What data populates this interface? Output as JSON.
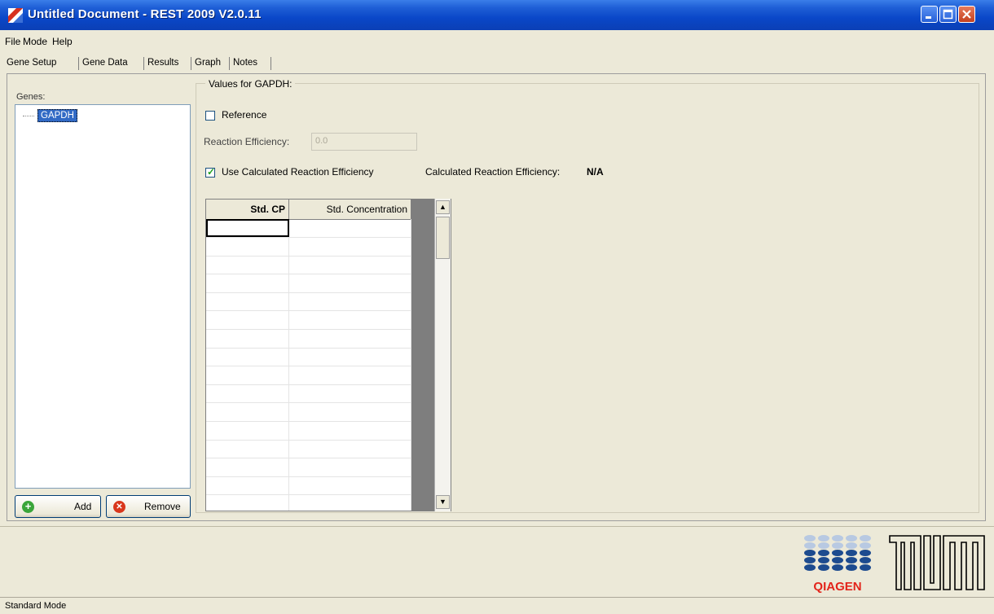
{
  "window": {
    "title": "Untitled Document - REST 2009 V2.0.11",
    "title_bar_color": "#0b47c8",
    "close_button_color": "#c4401f"
  },
  "menu": [
    {
      "label": "File"
    },
    {
      "label": "Mode"
    },
    {
      "label": "Help"
    }
  ],
  "tabs": [
    {
      "label": "Gene Setup",
      "active": true
    },
    {
      "label": "Gene Data"
    },
    {
      "label": "Results"
    },
    {
      "label": "Graph"
    },
    {
      "label": "Notes"
    }
  ],
  "genes": {
    "label": "Genes:",
    "items": [
      "GAPDH"
    ],
    "selected": "GAPDH",
    "add_label": "Add",
    "remove_label": "Remove",
    "add_icon": "plus-circle-icon",
    "remove_icon": "x-circle-icon"
  },
  "values": {
    "group_title": "Values for GAPDH:",
    "reference_label": "Reference",
    "reference_checked": false,
    "reaction_efficiency_label": "Reaction Efficiency:",
    "reaction_efficiency_value": "0.0",
    "use_calculated_label": "Use Calculated Reaction Efficiency",
    "use_calculated_checked": true,
    "calculated_label": "Calculated Reaction Efficiency:",
    "calculated_value": "N/A"
  },
  "grid": {
    "columns": [
      "Std. CP",
      "Std. Concentration"
    ],
    "rows": [
      [
        "",
        ""
      ],
      [
        "",
        ""
      ],
      [
        "",
        ""
      ],
      [
        "",
        ""
      ],
      [
        "",
        ""
      ],
      [
        "",
        ""
      ],
      [
        "",
        ""
      ],
      [
        "",
        ""
      ],
      [
        "",
        ""
      ],
      [
        "",
        ""
      ],
      [
        "",
        ""
      ],
      [
        "",
        ""
      ],
      [
        "",
        ""
      ],
      [
        "",
        ""
      ],
      [
        "",
        ""
      ],
      [
        "",
        ""
      ]
    ]
  },
  "logos": {
    "qiagen": "QIAGEN",
    "qiagen_color": "#e3241b",
    "qiagen_dot_color": "#1d4b8f"
  },
  "status": {
    "mode": "Standard Mode"
  }
}
